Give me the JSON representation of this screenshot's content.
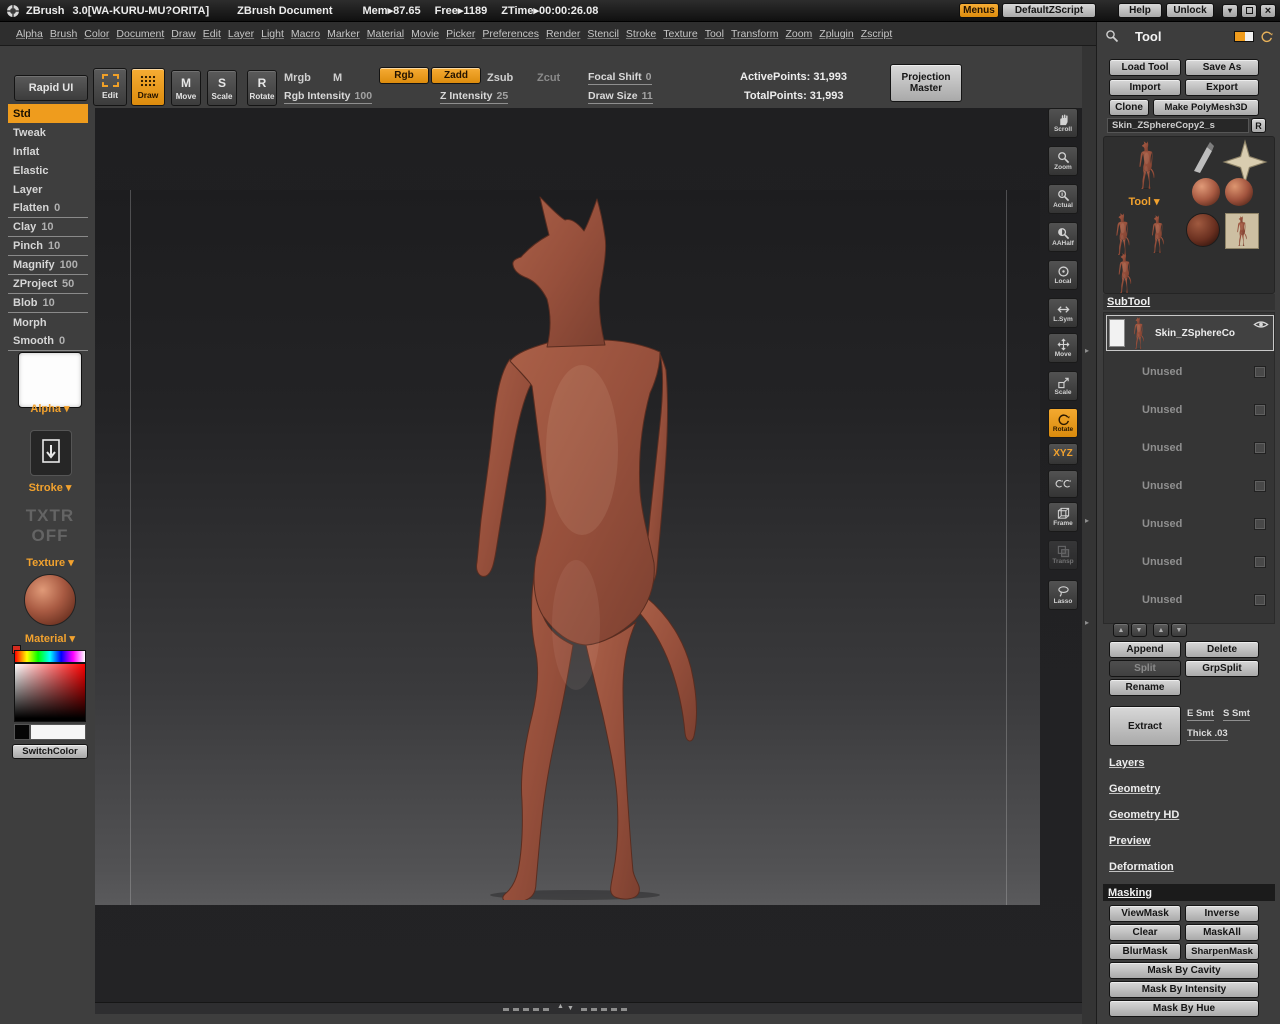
{
  "titlebar": {
    "app_name": "ZBrush",
    "version": "3.0[WA-KURU-MU?ORITA]",
    "document_title": "ZBrush Document",
    "mem": "Mem▸87.65",
    "free": "Free▸1189",
    "ztime": "ZTime▸00:00:26.08",
    "menus_button": "Menus",
    "zscript_button": "DefaultZScript",
    "help_button": "Help",
    "unlock_button": "Unlock"
  },
  "menubar": {
    "items": [
      "Alpha",
      "Brush",
      "Color",
      "Document",
      "Draw",
      "Edit",
      "Layer",
      "Light",
      "Macro",
      "Marker",
      "Material",
      "Movie",
      "Picker",
      "Preferences",
      "Render",
      "Stencil",
      "Stroke",
      "Texture",
      "Tool",
      "Transform",
      "Zoom",
      "Zplugin",
      "Zscript"
    ]
  },
  "topbar": {
    "rapid_ui": "Rapid UI",
    "edit_label": "Edit",
    "draw_label": "Draw",
    "move_label": "Move",
    "scale_label": "Scale",
    "rotate_label": "Rotate",
    "move_letter": "M",
    "scale_letter": "S",
    "rotate_letter": "R",
    "mrgb": "Mrgb",
    "m_toggle": "M",
    "rgb": "Rgb",
    "zadd": "Zadd",
    "zsub": "Zsub",
    "zcut": "Zcut",
    "rgb_intensity_label": "Rgb Intensity",
    "rgb_intensity_value": "100",
    "z_intensity_label": "Z Intensity",
    "z_intensity_value": "25",
    "focal_shift_label": "Focal Shift",
    "focal_shift_value": "0",
    "draw_size_label": "Draw Size",
    "draw_size_value": "11",
    "active_points": "ActivePoints: 31,993",
    "total_points": "TotalPoints: 31,993",
    "projection_line1": "Projection",
    "projection_line2": "Master"
  },
  "sidebar": {
    "brushes": [
      {
        "label": "Std",
        "value": ""
      },
      {
        "label": "Tweak",
        "value": ""
      },
      {
        "label": "Inflat",
        "value": ""
      },
      {
        "label": "Elastic",
        "value": ""
      },
      {
        "label": "Layer",
        "value": ""
      },
      {
        "label": "Flatten",
        "value": "0"
      },
      {
        "label": "Clay",
        "value": "10"
      },
      {
        "label": "Pinch",
        "value": "10"
      },
      {
        "label": "Magnify",
        "value": "100"
      },
      {
        "label": "ZProject",
        "value": "50"
      },
      {
        "label": "Blob",
        "value": "10"
      },
      {
        "label": "Morph",
        "value": ""
      },
      {
        "label": "Smooth",
        "value": "0"
      }
    ],
    "alpha_label": "Alpha ▾",
    "stroke_label": "Stroke ▾",
    "txtr_line1": "TXTR",
    "txtr_line2": "OFF",
    "texture_label": "Texture ▾",
    "material_label": "Material ▾",
    "switch_color": "SwitchColor"
  },
  "rightbar": {
    "items": [
      {
        "label": "Scroll"
      },
      {
        "label": "Zoom"
      },
      {
        "label": "Actual"
      },
      {
        "label": "AAHalf"
      },
      {
        "label": "Local"
      },
      {
        "label": "L.Sym"
      },
      {
        "label": "Move"
      },
      {
        "label": "Scale"
      },
      {
        "label": "Rotate"
      },
      {
        "label": "XYZ"
      },
      {
        "label": ""
      },
      {
        "label": "Frame"
      },
      {
        "label": "Transp"
      },
      {
        "label": "Lasso"
      }
    ]
  },
  "tool_panel": {
    "title": "Tool",
    "load_tool": "Load Tool",
    "save_as": "Save As",
    "import": "Import",
    "export": "Export",
    "clone": "Clone",
    "make_polymesh": "Make PolyMesh3D",
    "active_tool": "Skin_ZSphereCopy2_s",
    "r_button": "R",
    "tool_dropdown": "Tool ▾",
    "subtool": {
      "header": "SubTool",
      "items": [
        {
          "name": "Skin_ZSphereCo"
        },
        {
          "name": "Unused"
        },
        {
          "name": "Unused"
        },
        {
          "name": "Unused"
        },
        {
          "name": "Unused"
        },
        {
          "name": "Unused"
        },
        {
          "name": "Unused"
        },
        {
          "name": "Unused"
        }
      ],
      "append": "Append",
      "delete": "Delete",
      "split": "Split",
      "grpsplit": "GrpSplit",
      "rename": "Rename",
      "extract": "Extract",
      "e_smt": "E Smt",
      "s_smt": "S Smt",
      "thick": "Thick .03"
    },
    "sections": [
      "Layers",
      "Geometry",
      "Geometry HD",
      "Preview",
      "Deformation"
    ],
    "masking": {
      "header": "Masking",
      "view_mask": "ViewMask",
      "inverse": "Inverse",
      "clear": "Clear",
      "mask_all": "MaskAll",
      "blur_mask": "BlurMask",
      "sharpen_mask": "SharpenMask",
      "by_cavity": "Mask By Cavity",
      "by_intensity": "Mask By Intensity",
      "by_hue": "Mask By Hue"
    }
  },
  "colors": {
    "accent_orange": "#ef9c1d",
    "orange_text": "#f2a22e",
    "button_face": "#c2c2c2",
    "material_red": "#9a5240",
    "canvas_dark": "#202022"
  }
}
